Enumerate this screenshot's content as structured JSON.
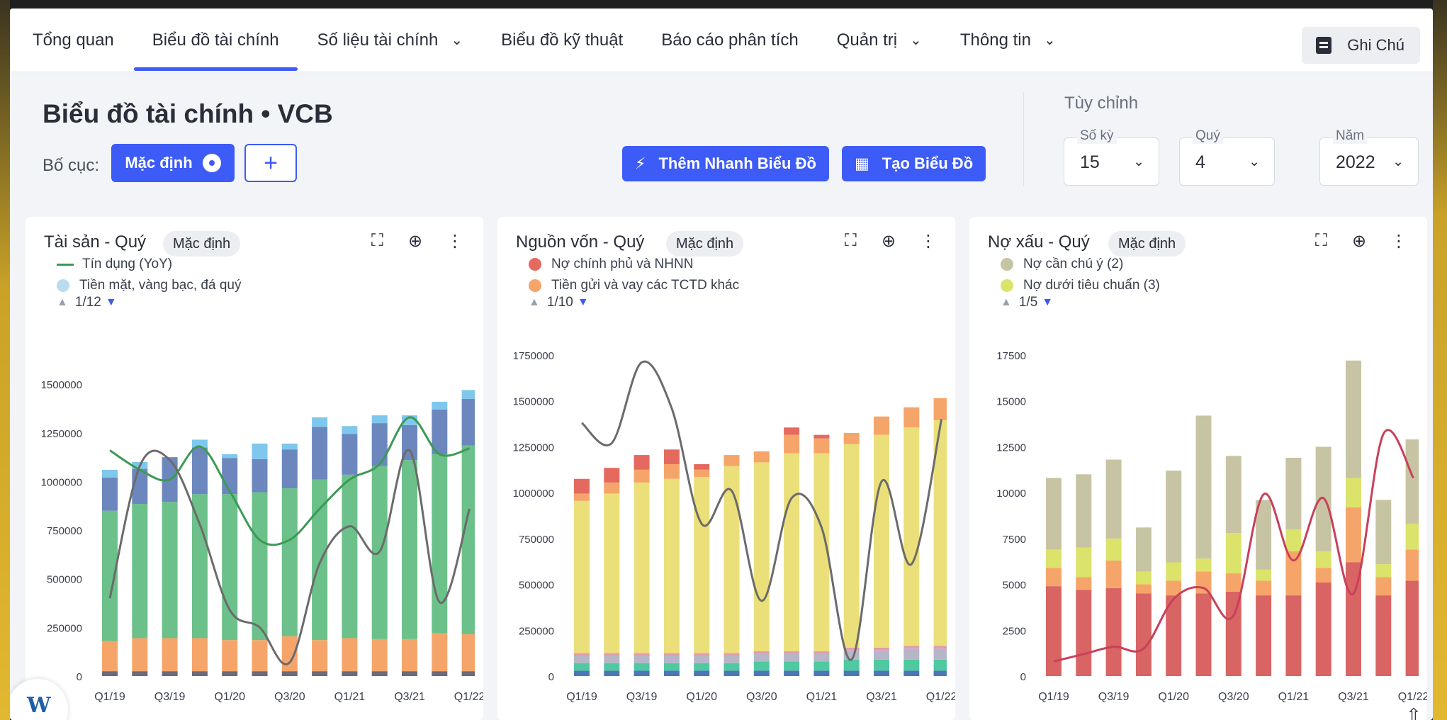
{
  "nav": {
    "items": [
      {
        "label": "Tổng quan",
        "dropdown": false,
        "active": false
      },
      {
        "label": "Biểu đồ tài chính",
        "dropdown": false,
        "active": true
      },
      {
        "label": "Số liệu tài chính",
        "dropdown": true,
        "active": false
      },
      {
        "label": "Biểu đồ kỹ thuật",
        "dropdown": false,
        "active": false
      },
      {
        "label": "Báo cáo phân tích",
        "dropdown": false,
        "active": false
      },
      {
        "label": "Quản trị",
        "dropdown": true,
        "active": false
      },
      {
        "label": "Thông tin",
        "dropdown": true,
        "active": false
      }
    ],
    "note_button": "Ghi Chú"
  },
  "header": {
    "title": "Biểu đồ tài chính • VCB",
    "layout_label": "Bố cục:",
    "layout_default": "Mặc định",
    "add_label": "+",
    "quick_add": "Thêm Nhanh Biểu Đồ",
    "create_chart": "Tạo Biểu Đồ",
    "customize_label": "Tùy chỉnh",
    "selects": [
      {
        "label": "Số kỳ",
        "value": "15"
      },
      {
        "label": "Quý",
        "value": "4"
      },
      {
        "label": "Năm",
        "value": "2022"
      }
    ]
  },
  "colors": {
    "accent": "#3d5bf6",
    "green": "#6cc08a",
    "steel": "#6b87bd",
    "sky": "#7fc7ec",
    "orange": "#f6a56a",
    "yellow": "#ebdf7a",
    "red": "#d96464",
    "khaki": "#c7c4a3",
    "lime": "#dbe36a",
    "gray_line": "#6b6b6b",
    "green_line": "#3c9a55",
    "red_line": "#c8405a"
  },
  "cards": [
    {
      "title": "Tài sản - Quý",
      "badge": "Mặc định",
      "legend": [
        {
          "label": "Tín dụng (YoY)",
          "kind": "line",
          "color": "#3c9a55"
        },
        {
          "label": "Tiền mặt, vàng bạc, đá quý",
          "kind": "dot",
          "color": "#b9dcf0"
        }
      ],
      "pager": "1/12"
    },
    {
      "title": "Nguồn vốn - Quý",
      "badge": "Mặc định",
      "legend": [
        {
          "label": "Nợ chính phủ và NHNN",
          "kind": "dot",
          "color": "#e46a60"
        },
        {
          "label": "Tiền gửi và vay các TCTD khác",
          "kind": "dot",
          "color": "#f6a56a"
        }
      ],
      "pager": "1/10"
    },
    {
      "title": "Nợ xấu - Quý",
      "badge": "Mặc định",
      "legend": [
        {
          "label": "Nợ cần chú ý (2)",
          "kind": "dot",
          "color": "#c7c4a3"
        },
        {
          "label": "Nợ dưới tiêu chuẩn (3)",
          "kind": "dot",
          "color": "#dbe36a"
        }
      ],
      "pager": "1/5"
    }
  ],
  "chart_data": [
    {
      "type": "bar",
      "stacked": true,
      "categories": [
        "Q1/19",
        "Q2/19",
        "Q3/19",
        "Q4/19",
        "Q1/20",
        "Q2/20",
        "Q3/20",
        "Q4/20",
        "Q1/21",
        "Q2/21",
        "Q3/21",
        "Q4/21",
        "Q1/22"
      ],
      "x_tick_labels": [
        "Q1/19",
        "Q3/19",
        "Q1/20",
        "Q3/20",
        "Q1/21",
        "Q3/21",
        "Q1/22"
      ],
      "yticks": [
        0,
        250000,
        500000,
        750000,
        1000000,
        1250000,
        1500000
      ],
      "ylim": [
        0,
        1650000
      ],
      "series": [
        {
          "color": "#6a6a7a",
          "values": [
            25000,
            25000,
            25000,
            25000,
            25000,
            25000,
            25000,
            25000,
            25000,
            25000,
            25000,
            25000,
            25000
          ]
        },
        {
          "color": "#f6a56a",
          "values": [
            155000,
            170000,
            170000,
            170000,
            160000,
            160000,
            180000,
            160000,
            170000,
            165000,
            165000,
            195000,
            190000
          ]
        },
        {
          "color": "#6cc08a",
          "values": [
            670000,
            690000,
            700000,
            740000,
            750000,
            760000,
            760000,
            825000,
            840000,
            890000,
            920000,
            920000,
            970000
          ]
        },
        {
          "color": "#6b87bd",
          "values": [
            170000,
            180000,
            230000,
            240000,
            185000,
            170000,
            200000,
            270000,
            210000,
            220000,
            180000,
            230000,
            240000
          ]
        },
        {
          "color": "#7fc7ec",
          "values": [
            40000,
            35000,
            0,
            40000,
            20000,
            80000,
            30000,
            50000,
            40000,
            40000,
            50000,
            40000,
            45000
          ]
        }
      ],
      "lines": [
        {
          "color": "#3c9a55",
          "values": [
            1160000,
            1060000,
            1010000,
            1180000,
            950000,
            700000,
            700000,
            860000,
            1010000,
            1090000,
            1330000,
            1140000,
            1170000
          ]
        },
        {
          "color": "#6b6b6b",
          "values": [
            400000,
            1080000,
            1110000,
            780000,
            340000,
            250000,
            70000,
            580000,
            770000,
            640000,
            1160000,
            380000,
            860000
          ]
        }
      ]
    },
    {
      "type": "bar",
      "stacked": true,
      "categories": [
        "Q1/19",
        "Q2/19",
        "Q3/19",
        "Q4/19",
        "Q1/20",
        "Q2/20",
        "Q3/20",
        "Q4/20",
        "Q1/21",
        "Q2/21",
        "Q3/21",
        "Q4/21",
        "Q1/22"
      ],
      "x_tick_labels": [
        "Q1/19",
        "Q3/19",
        "Q1/20",
        "Q3/20",
        "Q1/21",
        "Q3/21",
        "Q1/22"
      ],
      "yticks": [
        0,
        250000,
        500000,
        750000,
        1000000,
        1250000,
        1500000,
        1750000
      ],
      "ylim": [
        0,
        1750000
      ],
      "series": [
        {
          "color": "#4a78b4",
          "values": [
            30000,
            30000,
            30000,
            30000,
            30000,
            30000,
            30000,
            30000,
            30000,
            30000,
            30000,
            30000,
            30000
          ]
        },
        {
          "color": "#4ec9a0",
          "values": [
            40000,
            40000,
            40000,
            40000,
            40000,
            40000,
            50000,
            50000,
            50000,
            60000,
            60000,
            60000,
            60000
          ]
        },
        {
          "color": "#b6b6c8",
          "values": [
            40000,
            40000,
            40000,
            40000,
            40000,
            40000,
            40000,
            40000,
            40000,
            50000,
            50000,
            60000,
            60000
          ]
        },
        {
          "color": "#e59ab0",
          "values": [
            15000,
            15000,
            15000,
            15000,
            15000,
            15000,
            15000,
            15000,
            15000,
            15000,
            15000,
            15000,
            15000
          ]
        },
        {
          "color": "#ebdf7a",
          "values": [
            830000,
            870000,
            930000,
            950000,
            960000,
            1020000,
            1030000,
            1080000,
            1080000,
            1110000,
            1160000,
            1190000,
            1230000
          ]
        },
        {
          "color": "#f6a56a",
          "values": [
            40000,
            60000,
            70000,
            80000,
            40000,
            60000,
            60000,
            100000,
            80000,
            60000,
            100000,
            110000,
            120000
          ]
        },
        {
          "color": "#e46a60",
          "values": [
            80000,
            80000,
            80000,
            80000,
            30000,
            0,
            0,
            40000,
            20000,
            0,
            0,
            0,
            0
          ]
        }
      ],
      "lines": [
        {
          "color": "#6b6b6b",
          "values": [
            1380000,
            1270000,
            1710000,
            1460000,
            830000,
            1010000,
            410000,
            970000,
            810000,
            90000,
            1060000,
            610000,
            1400000
          ]
        }
      ]
    },
    {
      "type": "bar",
      "stacked": true,
      "categories": [
        "Q1/19",
        "Q2/19",
        "Q3/19",
        "Q4/19",
        "Q1/20",
        "Q2/20",
        "Q3/20",
        "Q4/20",
        "Q1/21",
        "Q2/21",
        "Q3/21",
        "Q4/21",
        "Q1/22"
      ],
      "x_tick_labels": [
        "Q1/19",
        "Q3/19",
        "Q1/20",
        "Q3/20",
        "Q1/21",
        "Q3/21",
        "Q1/22"
      ],
      "yticks": [
        0,
        2500,
        5000,
        7500,
        10000,
        12500,
        15000,
        17500
      ],
      "ylim": [
        0,
        17500
      ],
      "series": [
        {
          "color": "#d96464",
          "values": [
            4900,
            4700,
            4800,
            4500,
            4400,
            4500,
            4600,
            4400,
            4400,
            5100,
            6200,
            4400,
            5200
          ]
        },
        {
          "color": "#f6a56a",
          "values": [
            1000,
            700,
            1500,
            500,
            800,
            1200,
            1000,
            800,
            2400,
            800,
            3000,
            1000,
            1700
          ]
        },
        {
          "color": "#dbe36a",
          "values": [
            1000,
            1600,
            1200,
            700,
            1000,
            700,
            2200,
            600,
            1200,
            900,
            1600,
            700,
            1400
          ]
        },
        {
          "color": "#c7c4a3",
          "values": [
            3900,
            4000,
            4300,
            2400,
            5000,
            7800,
            4200,
            3800,
            3900,
            5700,
            6400,
            3500,
            4600
          ]
        }
      ],
      "lines": [
        {
          "color": "#c8405a",
          "values": [
            800,
            1200,
            1600,
            1500,
            4200,
            4800,
            3300,
            9900,
            6300,
            9700,
            4500,
            13200,
            10800
          ]
        }
      ]
    }
  ]
}
